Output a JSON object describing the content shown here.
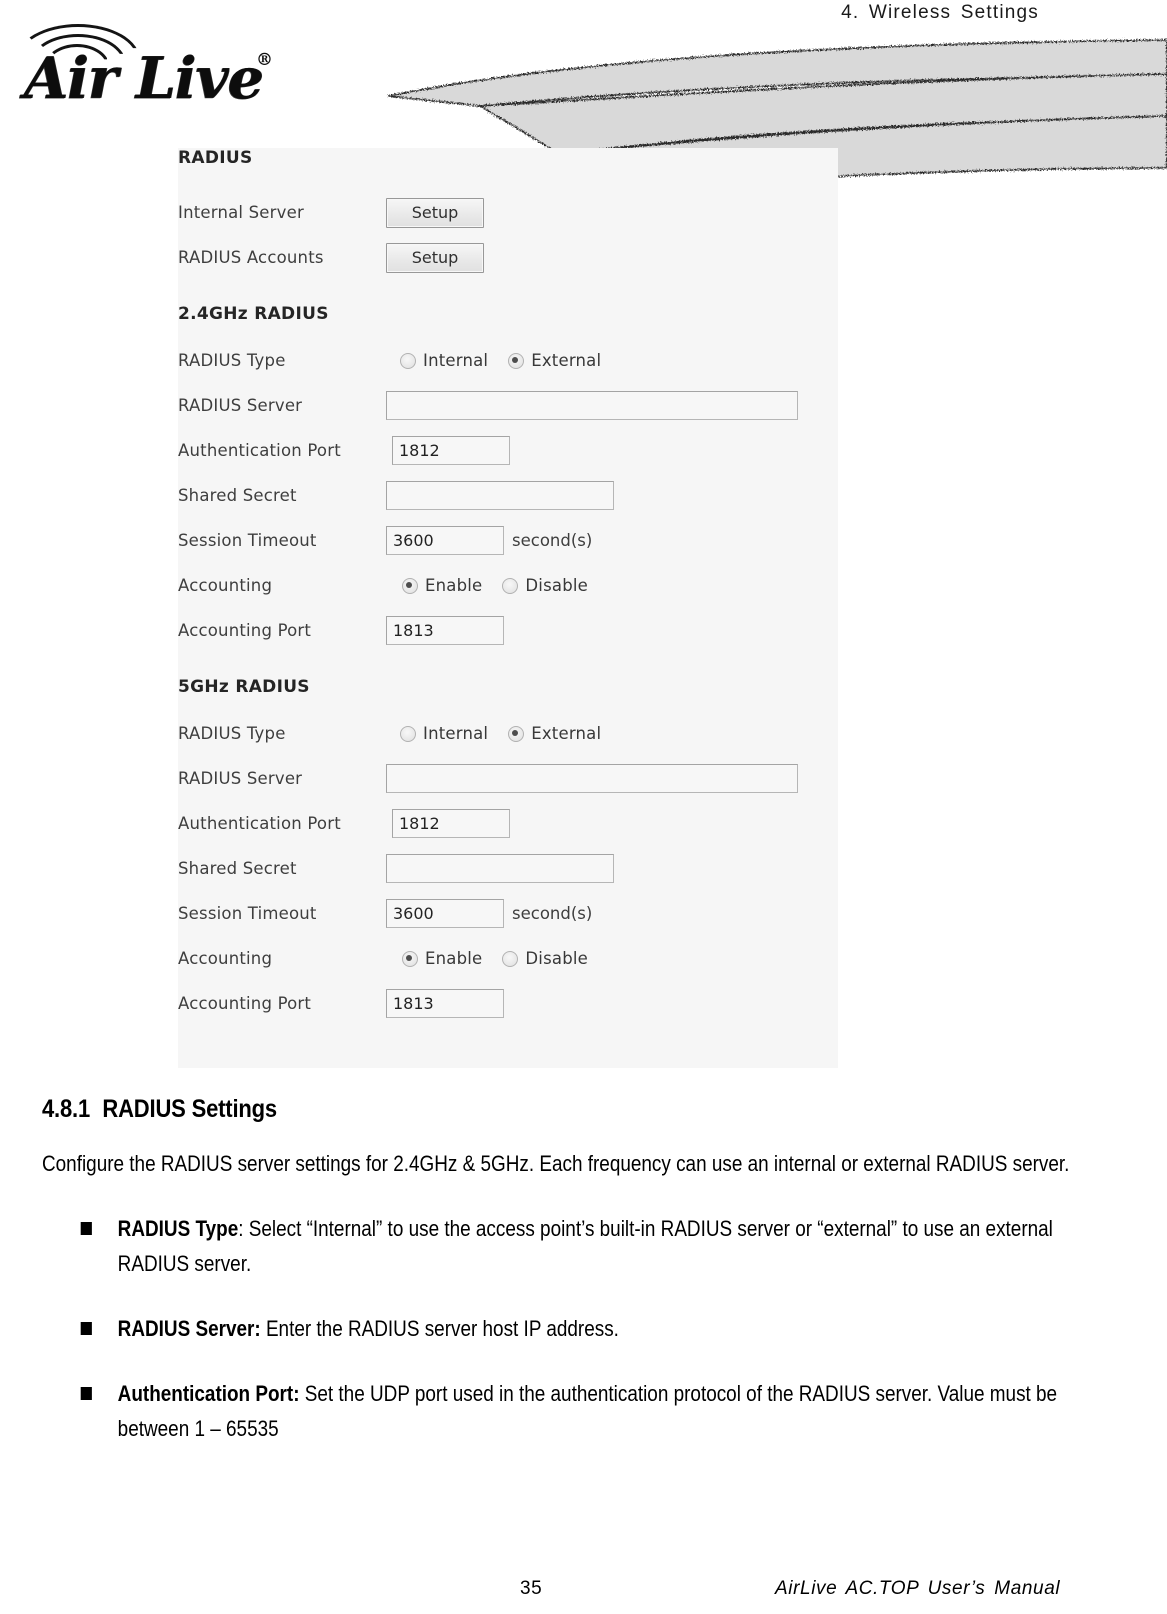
{
  "header": {
    "chapter_title": "4. Wireless Settings",
    "logo_text": "Air Live",
    "logo_registered": "®"
  },
  "ui_screenshot": {
    "radius_group": {
      "title": "RADIUS",
      "rows": [
        {
          "label": "Internal Server",
          "button": "Setup"
        },
        {
          "label": "RADIUS Accounts",
          "button": "Setup"
        }
      ]
    },
    "band_24": {
      "title": "2.4GHz RADIUS",
      "radius_type_label": "RADIUS Type",
      "radius_type_options": [
        {
          "label": "Internal",
          "selected": false
        },
        {
          "label": "External",
          "selected": true
        }
      ],
      "radius_server_label": "RADIUS Server",
      "radius_server_value": "",
      "auth_port_label": "Authentication Port",
      "auth_port_value": "1812",
      "shared_secret_label": "Shared Secret",
      "shared_secret_value": "",
      "session_timeout_label": "Session Timeout",
      "session_timeout_value": "3600",
      "session_timeout_unit": "second(s)",
      "accounting_label": "Accounting",
      "accounting_options": [
        {
          "label": "Enable",
          "selected": true
        },
        {
          "label": "Disable",
          "selected": false
        }
      ],
      "accounting_port_label": "Accounting Port",
      "accounting_port_value": "1813"
    },
    "band_5": {
      "title": "5GHz RADIUS",
      "radius_type_label": "RADIUS Type",
      "radius_type_options": [
        {
          "label": "Internal",
          "selected": false
        },
        {
          "label": "External",
          "selected": true
        }
      ],
      "radius_server_label": "RADIUS Server",
      "radius_server_value": "",
      "auth_port_label": "Authentication Port",
      "auth_port_value": "1812",
      "shared_secret_label": "Shared Secret",
      "shared_secret_value": "",
      "session_timeout_label": "Session Timeout",
      "session_timeout_value": "3600",
      "session_timeout_unit": "second(s)",
      "accounting_label": "Accounting",
      "accounting_options": [
        {
          "label": "Enable",
          "selected": true
        },
        {
          "label": "Disable",
          "selected": false
        }
      ],
      "accounting_port_label": "Accounting Port",
      "accounting_port_value": "1813"
    }
  },
  "document": {
    "section_number": "4.8.1",
    "section_title": "RADIUS Settings",
    "intro_paragraph": "Configure the RADIUS server settings for 2.4GHz & 5GHz. Each frequency can use an internal or external RADIUS server.",
    "bullets": [
      {
        "term": "RADIUS Type",
        "separator": ":",
        "description": " Select “Internal” to use the access point’s built-in RADIUS server or “external” to use an external RADIUS server."
      },
      {
        "term": "RADIUS Server:",
        "separator": "",
        "description": " Enter the RADIUS server host IP address."
      },
      {
        "term": "Authentication Port:",
        "separator": "",
        "description": " Set the UDP port used in the authentication protocol of the RADIUS server. Value must be between 1 – 65535"
      }
    ]
  },
  "footer": {
    "page_number": "35",
    "manual_name": "AirLive AC.TOP User’s Manual"
  },
  "colors": {
    "swoosh_fill": "#d9d9d9",
    "swoosh_edge": "#2b2b2b",
    "text": "#000000",
    "form_label": "#3a3a3a"
  }
}
